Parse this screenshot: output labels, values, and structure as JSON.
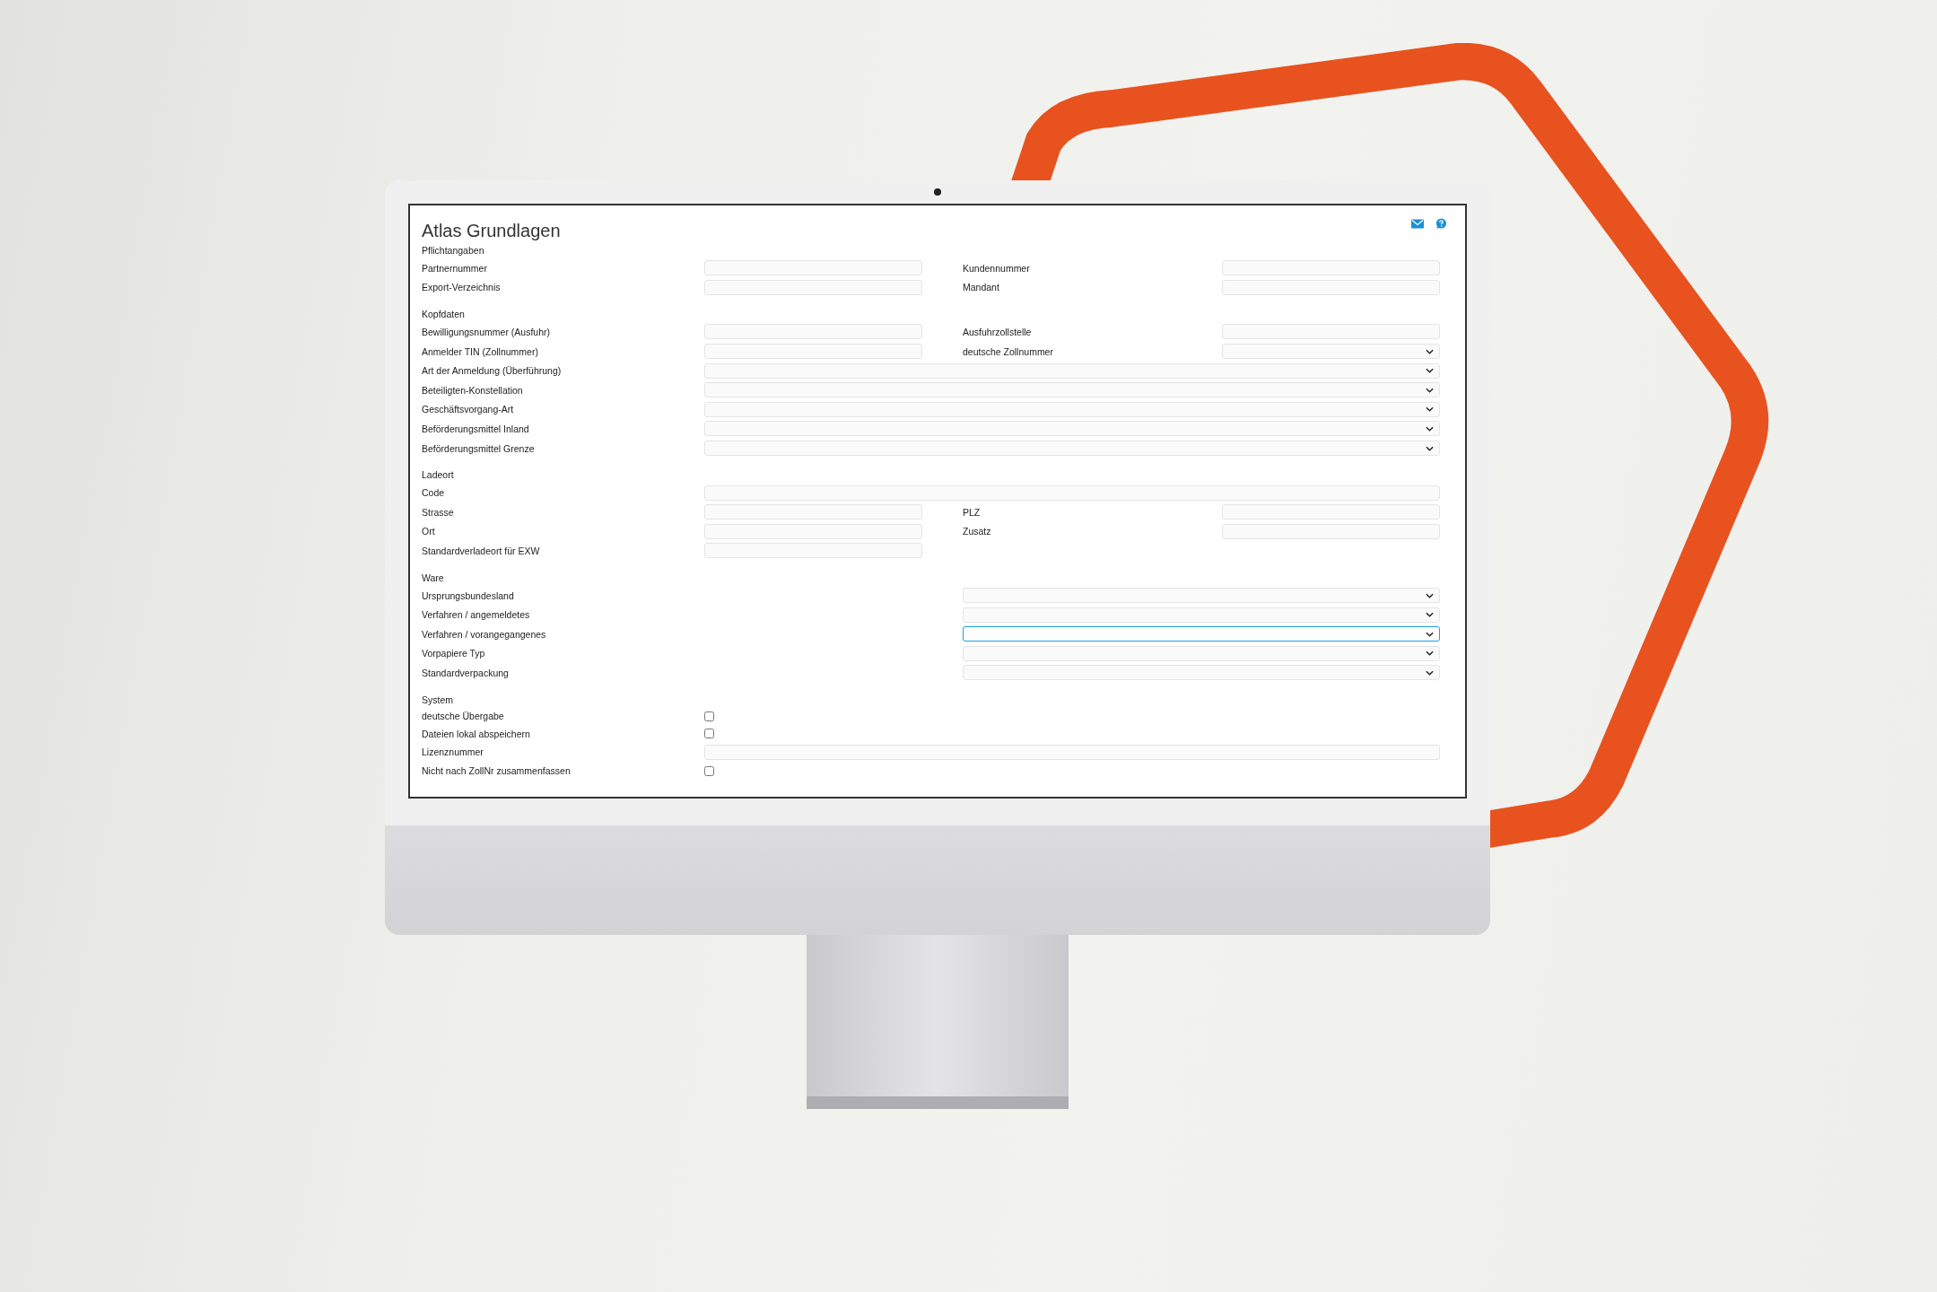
{
  "page": {
    "title": "Atlas Grundlagen"
  },
  "sections": [
    {
      "title": "Pflichtangaben",
      "rows": [
        {
          "kind": "pair",
          "label": "Partnernummer",
          "field": {
            "kind": "text",
            "focused": false
          },
          "label2": "Kundennummer",
          "field2": {
            "kind": "text",
            "focused": false
          }
        },
        {
          "kind": "pair",
          "label": "Export-Verzeichnis",
          "field": {
            "kind": "text",
            "focused": false
          },
          "label2": "Mandant",
          "field2": {
            "kind": "text",
            "focused": false
          }
        }
      ]
    },
    {
      "title": "Kopfdaten",
      "rows": [
        {
          "kind": "pair",
          "label": "Bewilligungsnummer (Ausfuhr)",
          "field": {
            "kind": "text",
            "focused": false
          },
          "label2": "Ausfuhrzollstelle",
          "field2": {
            "kind": "text",
            "focused": false
          }
        },
        {
          "kind": "pair",
          "label": "Anmelder TIN (Zollnummer)",
          "field": {
            "kind": "text",
            "focused": false
          },
          "label2": "deutsche Zollnummer",
          "field2": {
            "kind": "select",
            "focused": false
          }
        },
        {
          "kind": "wide",
          "label": "Art der Anmeldung (Überführung)",
          "field": {
            "kind": "select",
            "focused": false
          }
        },
        {
          "kind": "wide",
          "label": "Beteiligten-Konstellation",
          "field": {
            "kind": "select",
            "focused": false
          }
        },
        {
          "kind": "wide",
          "label": "Geschäftsvorgang-Art",
          "field": {
            "kind": "select",
            "focused": false
          }
        },
        {
          "kind": "wide",
          "label": "Beförderungsmittel Inland",
          "field": {
            "kind": "select",
            "focused": false
          }
        },
        {
          "kind": "wide",
          "label": "Beförderungsmittel Grenze",
          "field": {
            "kind": "select",
            "focused": false
          }
        }
      ]
    },
    {
      "title": "Ladeort",
      "rows": [
        {
          "kind": "wide",
          "label": "Code",
          "field": {
            "kind": "text",
            "focused": false
          }
        },
        {
          "kind": "pair",
          "label": "Strasse",
          "field": {
            "kind": "text",
            "focused": false
          },
          "label2": "PLZ",
          "field2": {
            "kind": "text",
            "focused": false
          }
        },
        {
          "kind": "pair",
          "label": "Ort",
          "field": {
            "kind": "text",
            "focused": false
          },
          "label2": "Zusatz",
          "field2": {
            "kind": "text",
            "focused": false
          }
        },
        {
          "kind": "single",
          "label": "Standardverladeort für EXW",
          "field": {
            "kind": "text",
            "focused": false
          }
        }
      ]
    },
    {
      "title": "Ware",
      "rows": [
        {
          "kind": "right",
          "label": "Ursprungsbundesland",
          "field": {
            "kind": "select",
            "focused": false
          }
        },
        {
          "kind": "right",
          "label": "Verfahren / angemeldetes",
          "field": {
            "kind": "select",
            "focused": false
          }
        },
        {
          "kind": "right",
          "label": "Verfahren / vorangegangenes",
          "field": {
            "kind": "select",
            "focused": true
          }
        },
        {
          "kind": "right",
          "label": "Vorpapiere Typ",
          "field": {
            "kind": "select",
            "focused": false
          }
        },
        {
          "kind": "right",
          "label": "Standardverpackung",
          "field": {
            "kind": "select",
            "focused": false
          }
        }
      ]
    },
    {
      "title": "System",
      "rows": [
        {
          "kind": "checkbox",
          "label": "deutsche Übergabe",
          "checked": false
        },
        {
          "kind": "checkbox",
          "label": "Dateien lokal abspeichern",
          "checked": false
        },
        {
          "kind": "wide",
          "label": "Lizenznummer",
          "field": {
            "kind": "text",
            "focused": false
          }
        },
        {
          "kind": "checkbox",
          "label": "Nicht nach ZollNr zusammenfassen",
          "checked": false
        }
      ]
    }
  ]
}
